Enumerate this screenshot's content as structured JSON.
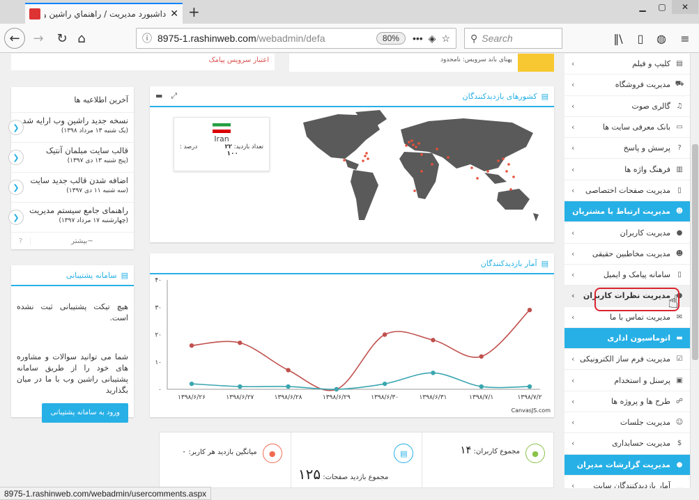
{
  "browser": {
    "tab_title": "داشبورد مديريت / راهنماي راشين وب",
    "url_main": "8975-1.rashinweb.com",
    "url_path": "/webadmin/defa",
    "zoom": "80%",
    "search_placeholder": "Search",
    "status_url": "8975-1.rashinweb.com/webadmin/usercomments.aspx"
  },
  "top": {
    "sms_credit": "اعتبار سرویس پیامک",
    "bandwidth": "پهنای باند سرویس: نامحدود"
  },
  "news": {
    "title": "آخرین اطلاعیه ها",
    "items": [
      {
        "title": "نسخه جدید راشین وب ارایه شد.",
        "date": "(یک شنبه ۱۳ مرداد ۱۳۹۸)"
      },
      {
        "title": "قالب سایت مبلمان آنتیک",
        "date": "(پنج شنبه ۱۳ دی ۱۳۹۷)"
      },
      {
        "title": "اضافه شدن قالب جدید سایت",
        "date": "(سه شنبه ۱۱ دی ۱۳۹۷)"
      },
      {
        "title": "راهنمای جامع سیستم مدیریت",
        "date": "(چهارشنبه ۱۷ مرداد ۱۳۹۷)"
      }
    ],
    "more": "بیشتر~",
    "help": "?"
  },
  "support": {
    "title": "سامانه پشتیبانی",
    "empty": "هیچ تیکت پشتیبانی ثبت نشده است.",
    "desc": "شما می توانید سوالات و مشاوره های خود را از طریق سامانه پشتیبانی راشین وب با ما در میان بگذارید",
    "button": "ورود به سامانه پشتیبانی"
  },
  "map": {
    "title": "کشورهای بازدیدکنندگان",
    "country": "Iran",
    "visits_label": "تعداد بازدید:",
    "visits": "۲۲",
    "percent_label": "درصد :",
    "percent": "۱۰۰"
  },
  "chart_panel": {
    "title": "آمار بازدیدکنندگان",
    "credit": "CanvasJS.com"
  },
  "chart_data": {
    "type": "line",
    "categories": [
      "۱۳۹۸/۶/۲۶",
      "۱۳۹۸/۶/۲۷",
      "۱۳۹۸/۶/۲۸",
      "۱۳۹۸/۶/۲۹",
      "۱۳۹۸/۶/۳۰",
      "۱۳۹۸/۶/۳۱",
      "۱۳۹۸/۷/۱",
      "۱۳۹۸/۷/۲"
    ],
    "y_ticks": [
      "۰",
      "۱۰",
      "۲۰",
      "۳۰",
      "۴۰"
    ],
    "ylim": [
      0,
      40
    ],
    "series": [
      {
        "color": "#c0504d",
        "values": [
          16,
          17,
          7,
          0,
          20,
          18,
          12,
          29
        ]
      },
      {
        "color": "#3aa6b0",
        "values": [
          2,
          1,
          1,
          0,
          2,
          6,
          1,
          1
        ]
      }
    ]
  },
  "stats": {
    "users_label": "مجموع کاربران:",
    "users": "۱۴",
    "pages_label": "مجموع بازدید صفحات:",
    "pages": "۱۲۵",
    "avg_label": "میانگین بازدید هر کاربر:",
    "avg": "۰"
  },
  "sidebar": [
    {
      "label": "کلیپ و فیلم",
      "icon": "film-icon",
      "glyph": "▤",
      "type": "item"
    },
    {
      "label": "مدیریت فروشگاه",
      "icon": "cart-icon",
      "glyph": "⛟",
      "type": "item"
    },
    {
      "label": "گالری صوت",
      "icon": "audio-icon",
      "glyph": "♫",
      "type": "item"
    },
    {
      "label": "بانک معرفی سایت ها",
      "icon": "monitor-icon",
      "glyph": "▭",
      "type": "item"
    },
    {
      "label": "پرسش و پاسخ",
      "icon": "question-icon",
      "glyph": "?",
      "type": "item"
    },
    {
      "label": "فرهنگ واژه ها",
      "icon": "book-icon",
      "glyph": "▥",
      "type": "item"
    },
    {
      "label": "مدیریت صفحات اختصاصی",
      "icon": "page-icon",
      "glyph": "▯",
      "type": "item"
    },
    {
      "label": "مدیریت ارتباط با مشتریان",
      "icon": "users-icon",
      "glyph": "☻",
      "type": "head"
    },
    {
      "label": "مدیریت کاربران",
      "icon": "user-icon",
      "glyph": "●",
      "type": "item"
    },
    {
      "label": "مدیریت مخاطبین حقیقی",
      "icon": "contacts-icon",
      "glyph": "☻",
      "type": "item"
    },
    {
      "label": "سامانه پیامک و ایمیل",
      "icon": "mobile-icon",
      "glyph": "▯",
      "type": "item"
    },
    {
      "label": "مدیریت نظرات کاربران",
      "icon": "comments-icon",
      "glyph": "●",
      "type": "active"
    },
    {
      "label": "مدیریت تماس با ما",
      "icon": "envelope-icon",
      "glyph": "✉",
      "type": "item"
    },
    {
      "label": "اتوماسیون اداری",
      "icon": "folder-icon",
      "glyph": "▬",
      "type": "head"
    },
    {
      "label": "مدیریت فرم ساز الکترونیکی",
      "icon": "form-icon",
      "glyph": "☑",
      "type": "item"
    },
    {
      "label": "پرسنل و استخدام",
      "icon": "briefcase-icon",
      "glyph": "▣",
      "type": "item"
    },
    {
      "label": "طرح ها و پروژه ها",
      "icon": "sitemap-icon",
      "glyph": "☍",
      "type": "item"
    },
    {
      "label": "مدیریت جلسات",
      "icon": "meeting-icon",
      "glyph": "☺",
      "type": "item"
    },
    {
      "label": "مدیریت حسابداری",
      "icon": "dollar-icon",
      "glyph": "$",
      "type": "item"
    },
    {
      "label": "مدیریت گزارشات مدیران",
      "icon": "report-icon",
      "glyph": "●",
      "type": "head"
    },
    {
      "label": "آمار بازدیدکنندگان سایت",
      "icon": "chart-icon",
      "glyph": "▁",
      "type": "item"
    }
  ]
}
